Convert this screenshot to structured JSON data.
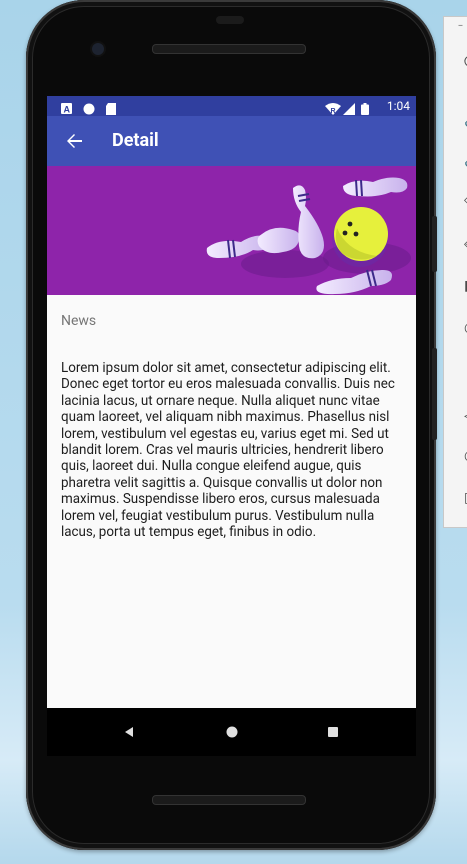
{
  "status_bar": {
    "time": "1:04",
    "left_icons": [
      "a-icon",
      "circle-icon",
      "sd-card-icon"
    ],
    "right_icons": [
      "wifi-icon",
      "signal-icon",
      "battery-icon"
    ]
  },
  "app_bar": {
    "title": "Detail",
    "back_icon": "arrow-back-icon"
  },
  "banner": {
    "image": "bowling-pins-and-ball-illustration"
  },
  "article": {
    "category": "News",
    "body": "Lorem ipsum dolor sit amet, consectetur adipiscing elit. Donec eget tortor eu eros malesuada convallis. Duis nec lacinia lacus, ut ornare neque. Nulla aliquet nunc vitae quam laoreet, vel aliquam nibh maximus. Phasellus nisl lorem, vestibulum vel egestas eu, varius eget mi. Sed ut blandit lorem. Cras vel mauris ultricies, hendrerit libero quis, laoreet dui. Nulla congue eleifend augue, quis pharetra velit sagittis a. Quisque convallis ut dolor non maximus. Suspendisse libero eros, cursus malesuada lorem vel, feugiat vestibulum purus. Vestibulum nulla lacus, porta ut tempus eget, finibus in odio."
  },
  "nav_bar": {
    "buttons": [
      "back-triangle-icon",
      "home-circle-icon",
      "recents-square-icon"
    ]
  },
  "colors": {
    "status_bar": "#303f9f",
    "app_bar": "#3f51b5",
    "banner": "#8e24aa",
    "ball": "#e6f03c"
  }
}
